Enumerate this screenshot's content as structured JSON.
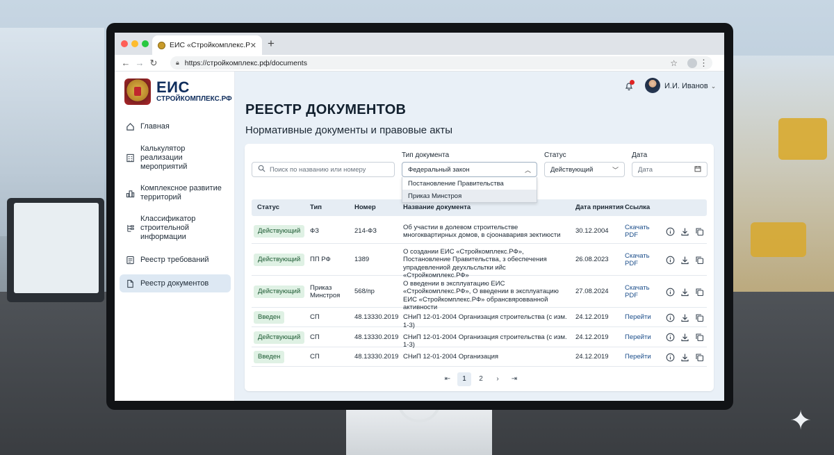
{
  "browser": {
    "tab_title": "ЕИС «Стройкомплекс.РФ»",
    "url": "https://стройкомплекс.рф/documents"
  },
  "logo": {
    "main": "ЕИС",
    "sub": "СТРОЙКОМПЛЕКС.РФ"
  },
  "sidebar": {
    "items": [
      {
        "label": "Главная",
        "icon": "home-icon",
        "active": false
      },
      {
        "label": "Калькулятор реализации мероприятий",
        "icon": "calculator-icon",
        "active": false
      },
      {
        "label": "Комплексное развитие территорий",
        "icon": "buildings-icon",
        "active": false
      },
      {
        "label": "Классификатор строительной информации",
        "icon": "classifier-icon",
        "active": false
      },
      {
        "label": "Реестр требований",
        "icon": "checklist-icon",
        "active": false
      },
      {
        "label": "Реестр документов",
        "icon": "document-icon",
        "active": true
      }
    ]
  },
  "header": {
    "user_name": "И.И. Иванов"
  },
  "page": {
    "title": "РЕЕСТР ДОКУМЕНТОВ",
    "subtitle": "Нормативные документы и правовые акты"
  },
  "filters": {
    "search_placeholder": "Поиск по названию или номеру",
    "type_label": "Тип документа",
    "type_value": "Федеральный закон",
    "type_options": [
      "Постановление Правительства",
      "Приказ Минстроя"
    ],
    "status_label": "Статус",
    "status_value": "Действующий",
    "date_label": "Дата",
    "date_placeholder": "Дата"
  },
  "table": {
    "headers": [
      "Статус",
      "Тип",
      "Номер",
      "Название документа",
      "Дата принятия",
      "Ссылка"
    ],
    "rows": [
      {
        "status": "Действующий",
        "type": "ФЗ",
        "number": "214-ФЗ",
        "name": "Об участии в долевом строительстве многоквартирных домов, в сјоонаваривя зектиюсти",
        "date": "30.12.2004",
        "link": "Скачать PDF"
      },
      {
        "status": "Действующий",
        "type": "ПП РФ",
        "number": "1389",
        "name": "О создании ЕИС «Стройкомплекс.РФ», Постановление Правительства, з обеспечения упрадевлениой деухльсльтки ийс «Стройкомплекс.РФ»",
        "date": "26.08.2023",
        "link": "Скачать PDF"
      },
      {
        "status": "Действующий",
        "type": "Приказ Минстроя",
        "number": "568/пр",
        "name": "О введении в эксплуатацию ЕИС «Стройкомплекс.РФ», О введении в эксплуатацию ЕИС «Стройкомплекс.РФ» обрансвяровванной активности",
        "date": "27.08.2024",
        "link": "Скачать PDF"
      },
      {
        "status": "Введен",
        "type": "СП",
        "number": "48.13330.2019",
        "name": "СНиП 12-01-2004 Организация строительства (с изм. 1-3)",
        "date": "24.12.2019",
        "link": "Перейти"
      },
      {
        "status": "Действующий",
        "type": "СП",
        "number": "48.13330.2019",
        "name": "СНиП 12-01-2004 Организация строительства (с изм. 1-3)",
        "date": "24.12.2019",
        "link": "Перейти"
      },
      {
        "status": "Введен",
        "type": "СП",
        "number": "48.13330.2019",
        "name": "СНиП 12-01-2004 Организация",
        "date": "24.12.2019",
        "link": "Перейти"
      }
    ]
  },
  "pagination": {
    "pages": [
      "1",
      "2"
    ],
    "current": "1"
  }
}
